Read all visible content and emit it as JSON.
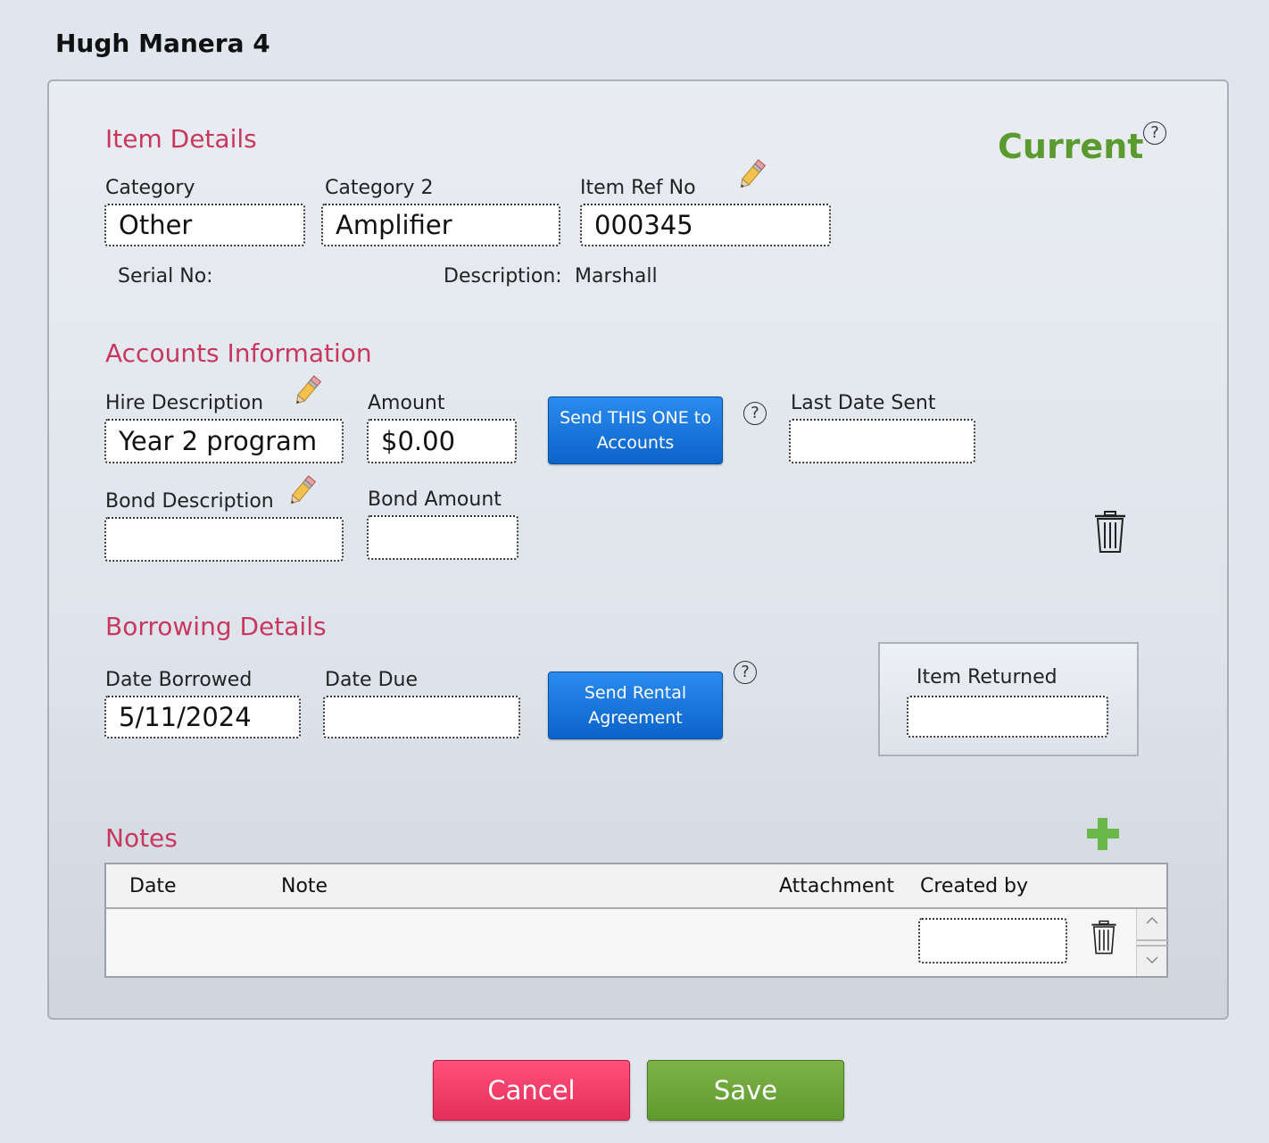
{
  "window_title": "Hugh Manera 4",
  "status": {
    "text": "Current",
    "color": "#5a9a2e",
    "help_icon": "question-circle-icon"
  },
  "item_details": {
    "title": "Item Details",
    "category_label": "Category",
    "category_value": "Other",
    "category2_label": "Category 2",
    "category2_value": "Amplifier",
    "item_ref_label": "Item Ref No",
    "item_ref_value": "000345",
    "serial_label": "Serial No:",
    "serial_value": "",
    "description_label": "Description:",
    "description_value": "Marshall"
  },
  "accounts": {
    "title": "Accounts Information",
    "hire_desc_label": "Hire Description",
    "hire_desc_value": "Year 2 program",
    "amount_label": "Amount",
    "amount_value": "$0.00",
    "send_button_line1": "Send THIS ONE to",
    "send_button_line2": "Accounts",
    "last_date_label": "Last Date Sent",
    "last_date_value": "",
    "bond_desc_label": "Bond Description",
    "bond_desc_value": "",
    "bond_amount_label": "Bond Amount",
    "bond_amount_value": ""
  },
  "borrowing": {
    "title": "Borrowing Details",
    "date_borrowed_label": "Date Borrowed",
    "date_borrowed_value": "5/11/2024",
    "date_due_label": "Date Due",
    "date_due_value": "",
    "send_rental_line1": "Send Rental",
    "send_rental_line2": "Agreement",
    "item_returned_label": "Item Returned",
    "item_returned_value": ""
  },
  "notes": {
    "title": "Notes",
    "columns": [
      "Date",
      "Note",
      "Attachment",
      "Created by"
    ],
    "rows": [
      {
        "date": "",
        "note": "",
        "attachment": "",
        "created_by": ""
      }
    ]
  },
  "footer": {
    "cancel_label": "Cancel",
    "save_label": "Save"
  },
  "colors": {
    "section_title": "#c8385e",
    "accent_blue": "#0b63c9",
    "cancel": "#e42e5c",
    "save": "#5f9a2f"
  }
}
